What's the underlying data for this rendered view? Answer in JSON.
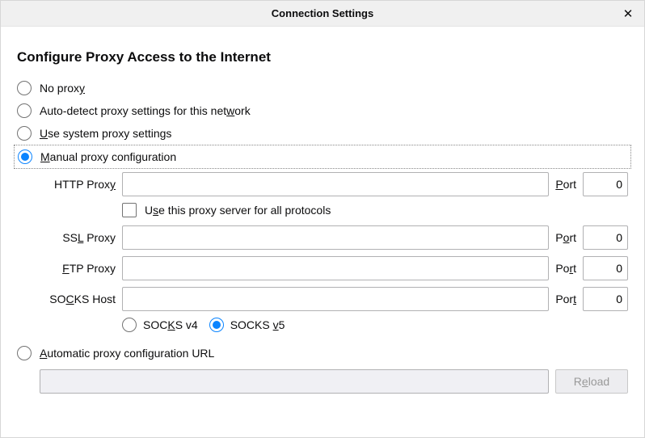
{
  "title": "Connection Settings",
  "heading": "Configure Proxy Access to the Internet",
  "options": {
    "no_proxy": {
      "label": "No proxy",
      "ul": "y",
      "checked": false
    },
    "auto_detect": {
      "label_pre": "Auto-detect proxy settings for this net",
      "ul": "w",
      "label_post": "ork",
      "checked": false
    },
    "system": {
      "ul": "U",
      "label_post": "se system proxy settings",
      "checked": false
    },
    "manual": {
      "ul": "M",
      "label_post": "anual proxy configuration",
      "checked": true
    },
    "auto_url": {
      "ul": "A",
      "label_post": "utomatic proxy configuration URL",
      "checked": false
    }
  },
  "proxies": {
    "http": {
      "label_pre": "HTTP Prox",
      "ul": "y",
      "host": "",
      "port_label_ul": "P",
      "port_label_post": "ort",
      "port": "0"
    },
    "ssl": {
      "label_pre": "SS",
      "ul": "L",
      "label_post": " Proxy",
      "host": "",
      "port_label_pre": "P",
      "port_label_ul": "o",
      "port_label_post": "rt",
      "port": "0"
    },
    "ftp": {
      "ul": "F",
      "label_post": "TP Proxy",
      "host": "",
      "port_label_pre": "Po",
      "port_label_ul": "r",
      "port_label_post": "t",
      "port": "0"
    },
    "socks": {
      "label_pre": "SO",
      "ul": "C",
      "label_post": "KS Host",
      "host": "",
      "port_label_pre": "Por",
      "port_label_ul": "t",
      "port": "0"
    }
  },
  "use_same_proxy": {
    "label_pre": "U",
    "ul": "s",
    "label_post": "e this proxy server for all protocols",
    "checked": false
  },
  "socks_version": {
    "v4": {
      "label_pre": "SOC",
      "ul": "K",
      "label_post": "S v4",
      "checked": false
    },
    "v5": {
      "label_pre": "SOCKS ",
      "ul": "v",
      "label_post": "5",
      "checked": true
    }
  },
  "auto_url": {
    "value": ""
  },
  "reload": {
    "label_pre": "R",
    "ul": "e",
    "label_post": "load"
  }
}
